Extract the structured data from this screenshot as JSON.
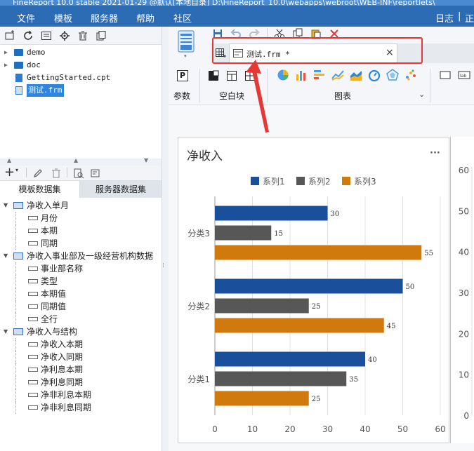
{
  "window": {
    "title": "FineReport 10.0 stable 2021-01-29 @默认[本地目录]   D:\\FineReport_10.0\\webapps\\webroot\\WEB-INF\\reportlets\\"
  },
  "menubar": {
    "items": [
      "文件",
      "模板",
      "服务器",
      "帮助",
      "社区"
    ],
    "right_items": [
      "日志",
      "正"
    ]
  },
  "file_tree": {
    "items": [
      {
        "label": "demo",
        "type": "folder"
      },
      {
        "label": "doc",
        "type": "folder"
      },
      {
        "label": "GettingStarted.cpt",
        "type": "file"
      },
      {
        "label": "测试.frm",
        "type": "file",
        "selected": true
      }
    ]
  },
  "datasets": {
    "tabs": [
      "模板数据集",
      "服务器数据集"
    ],
    "active_tab": 0,
    "groups": [
      {
        "name": "净收入单月",
        "fields": [
          "月份",
          "本期",
          "同期"
        ]
      },
      {
        "name": "净收入事业部及一级经营机构数据",
        "fields": [
          "事业部名称",
          "类型",
          "本期值",
          "同期值",
          "全行"
        ]
      },
      {
        "name": "净收入与结构",
        "fields": [
          "净收入本期",
          "净收入同期",
          "净利息本期",
          "净利息同期",
          "净非利息本期",
          "净非利息同期"
        ]
      }
    ]
  },
  "editor": {
    "tab_label": "测试.frm *",
    "tab_close": "×"
  },
  "ribbon": {
    "groups": [
      "参数",
      "空白块",
      "图表"
    ],
    "param_glyph": "P"
  },
  "chart_data": {
    "type": "bar",
    "orientation": "horizontal",
    "title": "净收入",
    "menu_glyph": "···",
    "categories": [
      "分类1",
      "分类2",
      "分类3"
    ],
    "series": [
      {
        "name": "系列1",
        "color": "#1a4f9c",
        "values": [
          40,
          50,
          30
        ]
      },
      {
        "name": "系列2",
        "color": "#575757",
        "values": [
          35,
          25,
          15
        ]
      },
      {
        "name": "系列3",
        "color": "#d07a0d",
        "values": [
          25,
          45,
          55
        ]
      }
    ],
    "xlim": [
      0,
      60
    ],
    "xticks": [
      0,
      10,
      20,
      30,
      40,
      50,
      60
    ],
    "grid": true,
    "legend": "top"
  },
  "second_chart": {
    "yticks": [
      0,
      10,
      20,
      30,
      40,
      50,
      60
    ]
  }
}
